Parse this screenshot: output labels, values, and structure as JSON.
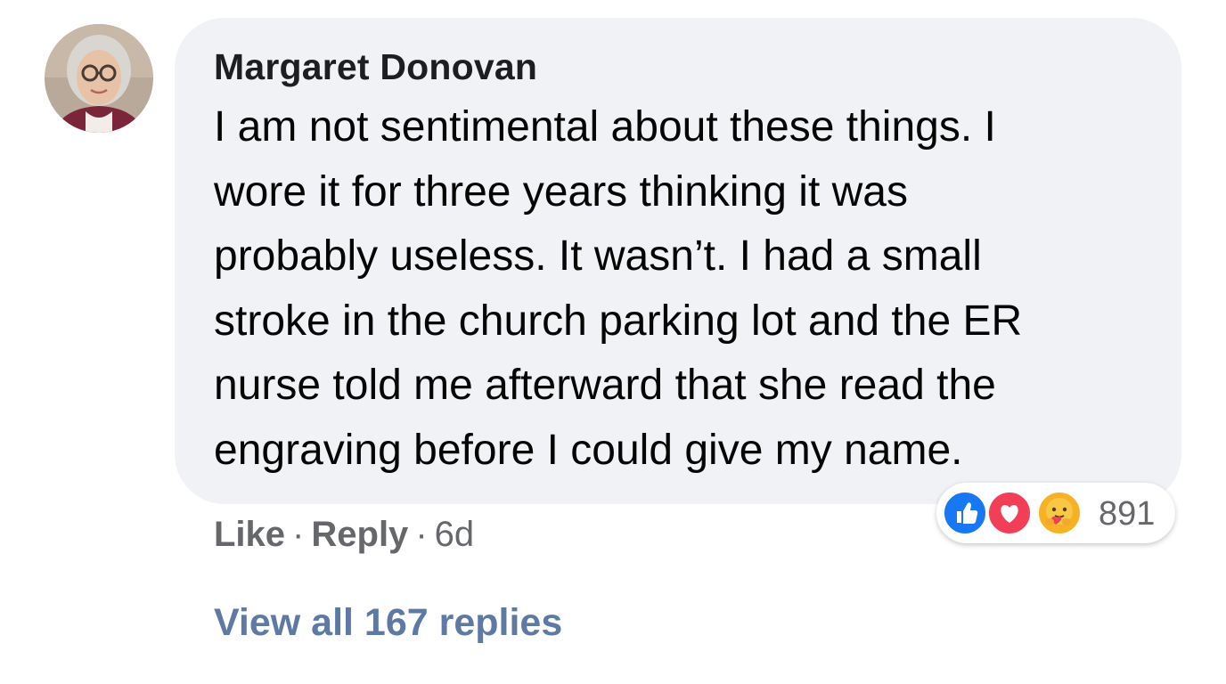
{
  "comment": {
    "author": "Margaret Donovan",
    "text_lines": [
      "I am not sentimental about these things. I",
      "wore it for three years thinking it was",
      "probably useless. It wasn’t. I had a small",
      "stroke in the church parking lot and the ER",
      "nurse told me afterward that she read the",
      "engraving before I could give my name."
    ],
    "reactions": {
      "icons": [
        "like-icon",
        "love-icon",
        "care-icon"
      ],
      "count": "891"
    },
    "actions": {
      "like_label": "Like",
      "separator": "·",
      "reply_label": "Reply",
      "timestamp": "6d"
    },
    "view_replies_label": "View all 167 replies"
  },
  "colors": {
    "bubble": "#f0f2f5",
    "meta_text": "#65676b",
    "link": "#5e7aa4",
    "like": "#1877f2",
    "love": "#f33e58",
    "care": "#f7b125"
  }
}
